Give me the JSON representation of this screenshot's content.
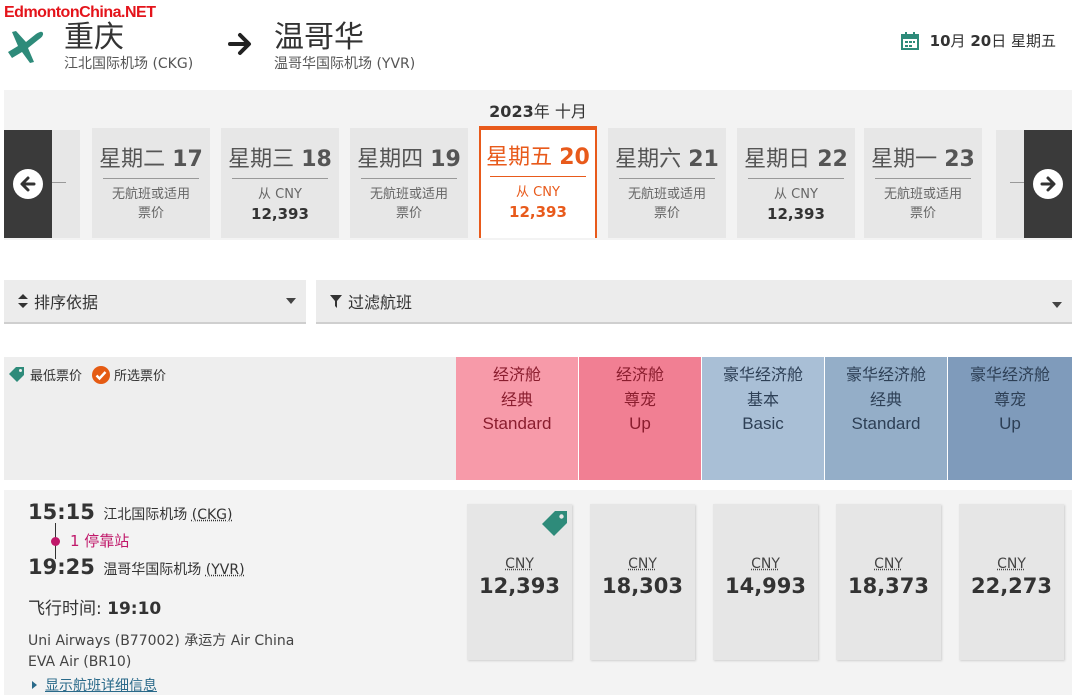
{
  "watermark": "EdmontonChina.NET",
  "route": {
    "origin": {
      "city": "重庆",
      "airport": "江北国际机场 (CKG)"
    },
    "destination": {
      "city": "温哥华",
      "airport": "温哥华国际机场 (YVR)"
    },
    "date_parts": {
      "month": "10",
      "month_suffix": "月",
      "day": "20",
      "day_suffix": "日",
      "weekday": "星期五"
    }
  },
  "calendar": {
    "year": "2023",
    "year_suffix": "年",
    "month": "十月",
    "prev_label": "上一页",
    "next_label": "下一页",
    "days": [
      {
        "weekday": "星期二",
        "day": "17",
        "line1": "无航班或适用",
        "line2": "票价",
        "active": false
      },
      {
        "weekday": "星期三",
        "day": "18",
        "line1": "从 CNY",
        "line2": "12,393",
        "active": false
      },
      {
        "weekday": "星期四",
        "day": "19",
        "line1": "无航班或适用",
        "line2": "票价",
        "active": false
      },
      {
        "weekday": "星期五",
        "day": "20",
        "line1": "从 CNY",
        "line2": "12,393",
        "active": true
      },
      {
        "weekday": "星期六",
        "day": "21",
        "line1": "无航班或适用",
        "line2": "票价",
        "active": false
      },
      {
        "weekday": "星期日",
        "day": "22",
        "line1": "从 CNY",
        "line2": "12,393",
        "active": false
      },
      {
        "weekday": "星期一",
        "day": "23",
        "line1": "无航班或适用",
        "line2": "票价",
        "active": false
      }
    ]
  },
  "controls": {
    "sort_label": "排序依据",
    "filter_label": "过滤航班"
  },
  "legend": {
    "lowest": "最低票价",
    "selected": "所选票价"
  },
  "fare_columns": [
    {
      "l1": "经济舱",
      "l2": "经典",
      "l3": "Standard",
      "bg": "#f79aa9",
      "color": "#8a1d2e"
    },
    {
      "l1": "经济舱",
      "l2": "尊宠",
      "l3": "Up",
      "bg": "#f17f93",
      "color": "#8a1d2e"
    },
    {
      "l1": "豪华经济舱",
      "l2": "基本",
      "l3": "Basic",
      "bg": "#a9bfd6",
      "color": "#2d3f55"
    },
    {
      "l1": "豪华经济舱",
      "l2": "经典",
      "l3": "Standard",
      "bg": "#94aec8",
      "color": "#2d3f55"
    },
    {
      "l1": "豪华经济舱",
      "l2": "尊宠",
      "l3": "Up",
      "bg": "#7f9bbb",
      "color": "#2d3f55"
    }
  ],
  "flight": {
    "depart_time": "15:15",
    "depart_airport": "江北国际机场",
    "depart_code": "(CKG)",
    "stops": "1 停靠站",
    "arrive_time": "19:25",
    "arrive_airport": "温哥华国际机场",
    "arrive_code": "(YVR)",
    "duration_label": "飞行时间:",
    "duration": "19:10",
    "carrier1": "Uni Airways (B77002) 承运方 Air China",
    "carrier2": "EVA Air (BR10)",
    "details_link": "显示航班详细信息",
    "prices": [
      {
        "currency": "CNY",
        "amount": "12,393",
        "lowest": true
      },
      {
        "currency": "CNY",
        "amount": "18,303",
        "lowest": false
      },
      {
        "currency": "CNY",
        "amount": "14,993",
        "lowest": false
      },
      {
        "currency": "CNY",
        "amount": "18,373",
        "lowest": false
      },
      {
        "currency": "CNY",
        "amount": "22,273",
        "lowest": false
      }
    ]
  },
  "colors": {
    "accent": "#e85a1b",
    "brand_green": "#2e8b7a",
    "stop_pink": "#c0186a",
    "check_orange": "#e55b13"
  }
}
